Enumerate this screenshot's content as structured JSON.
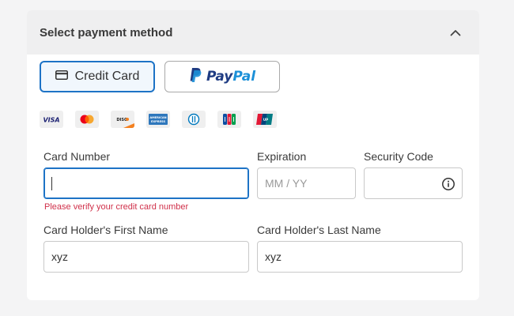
{
  "panel": {
    "title": "Select payment method"
  },
  "methods": {
    "credit_card_label": "Credit Card",
    "paypal_label_pay": "Pay",
    "paypal_label_pal": "Pal"
  },
  "card_brands": [
    "visa-icon",
    "mastercard-icon",
    "discover-icon",
    "amex-icon",
    "diners-club-icon",
    "jcb-icon",
    "unionpay-icon"
  ],
  "form": {
    "card_number_label": "Card Number",
    "card_number_value": "",
    "card_number_error": "Please verify your credit card number",
    "expiration_label": "Expiration",
    "expiration_placeholder": "MM / YY",
    "security_code_label": "Security Code",
    "first_name_label": "Card Holder's First Name",
    "first_name_value": "xyz",
    "last_name_label": "Card Holder's Last Name",
    "last_name_value": "xyz"
  },
  "colors": {
    "accent": "#1d73c6",
    "error": "#d0304a",
    "header_bg": "#efeff0",
    "page_bg": "#f4f4f5"
  }
}
